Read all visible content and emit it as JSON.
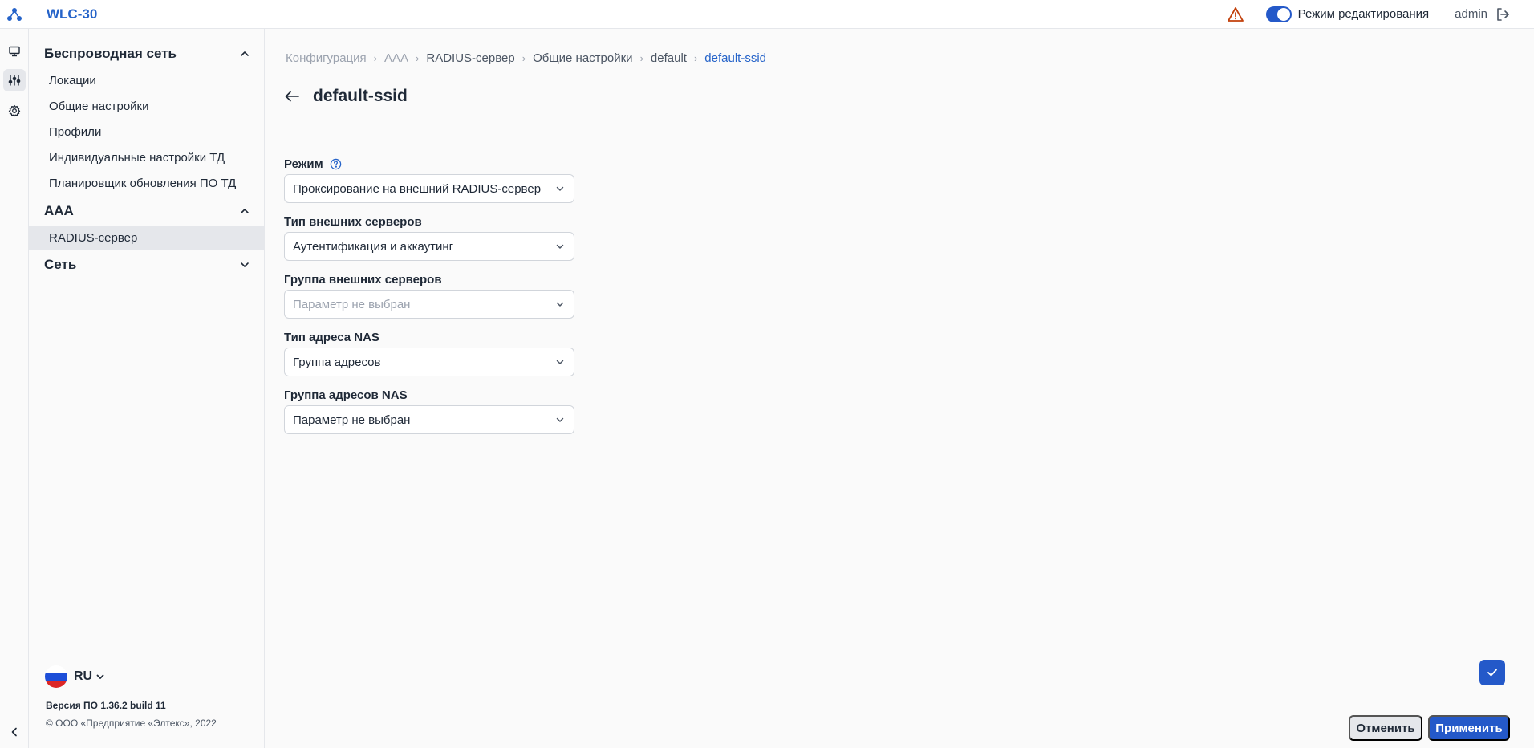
{
  "header": {
    "app_title": "WLC-30",
    "edit_mode_label": "Режим редактирования",
    "edit_mode_on": true,
    "user": "admin"
  },
  "rail": {
    "items": [
      {
        "icon": "monitor-icon"
      },
      {
        "icon": "sliders-icon",
        "active": true
      },
      {
        "icon": "gear-icon"
      }
    ]
  },
  "sidebar": {
    "sections": [
      {
        "title": "Беспроводная сеть",
        "expanded": true,
        "items": [
          "Локации",
          "Общие настройки",
          "Профили",
          "Индивидуальные настройки ТД",
          "Планировщик обновления ПО ТД"
        ]
      },
      {
        "title": "AAA",
        "expanded": true,
        "items": [
          "RADIUS-сервер"
        ],
        "active_item": "RADIUS-сервер"
      },
      {
        "title": "Сеть",
        "expanded": false,
        "items": []
      }
    ],
    "language": "RU",
    "version": "Версия ПО 1.36.2 build 11",
    "copyright": "© ООО «Предприятие «Элтекс», 2022"
  },
  "breadcrumb": [
    "Конфигурация",
    "AAA",
    "RADIUS-сервер",
    "Общие настройки",
    "default",
    "default-ssid"
  ],
  "page": {
    "title": "default-ssid"
  },
  "form": {
    "mode": {
      "label": "Режим",
      "value": "Проксирование на внешний RADIUS-сервер"
    },
    "server_type": {
      "label": "Тип внешних серверов",
      "value": "Аутентификация и аккаутинг"
    },
    "server_group": {
      "label": "Группа внешних серверов",
      "placeholder": "Параметр не выбран"
    },
    "nas_type": {
      "label": "Тип адреса NAS",
      "value": "Группа адресов"
    },
    "nas_group": {
      "label": "Группа адресов NAS",
      "value": "Параметр не выбран"
    }
  },
  "footer": {
    "cancel": "Отменить",
    "apply": "Применить"
  },
  "colors": {
    "accent": "#2459c9",
    "brand": "#2563c9",
    "warning": "#c2410c"
  }
}
